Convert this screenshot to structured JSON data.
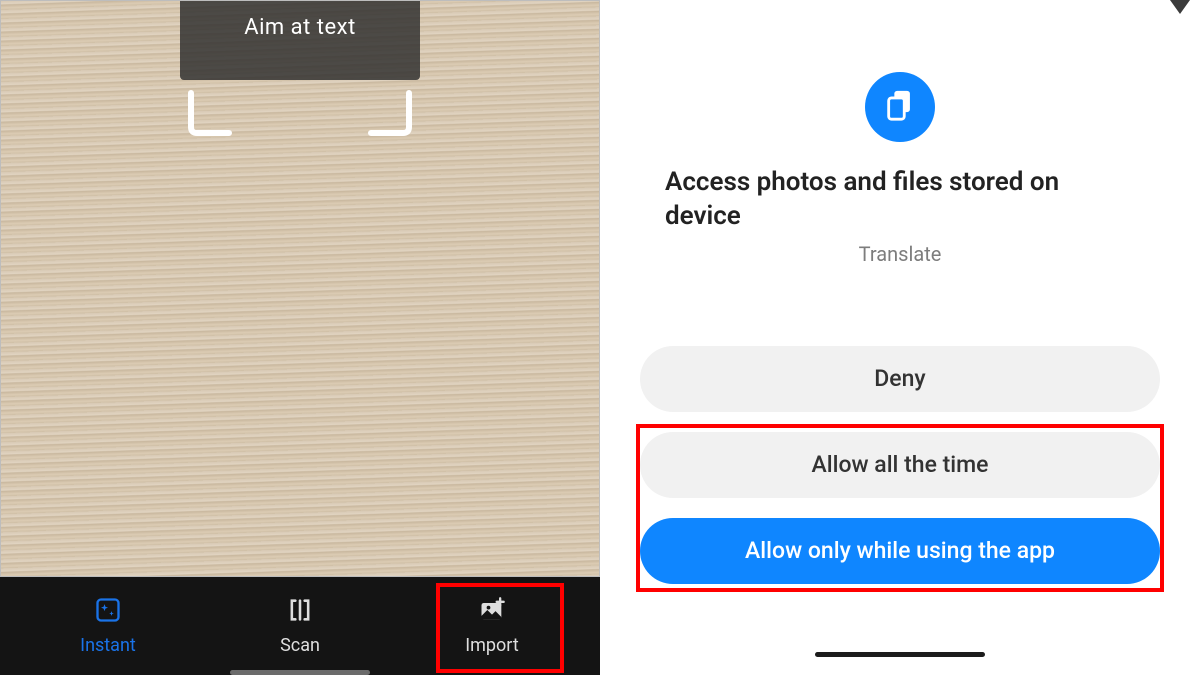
{
  "left": {
    "aim_text": "Aim at text",
    "nav": {
      "instant": "Instant",
      "scan": "Scan",
      "import": "Import"
    }
  },
  "right": {
    "title": "Access photos and files stored on device",
    "subtitle": "Translate",
    "buttons": {
      "deny": "Deny",
      "allow_all": "Allow all the time",
      "allow_while": "Allow only while using the app"
    }
  },
  "colors": {
    "accent_blue": "#0f86ff",
    "highlight_red": "#ff0000"
  }
}
